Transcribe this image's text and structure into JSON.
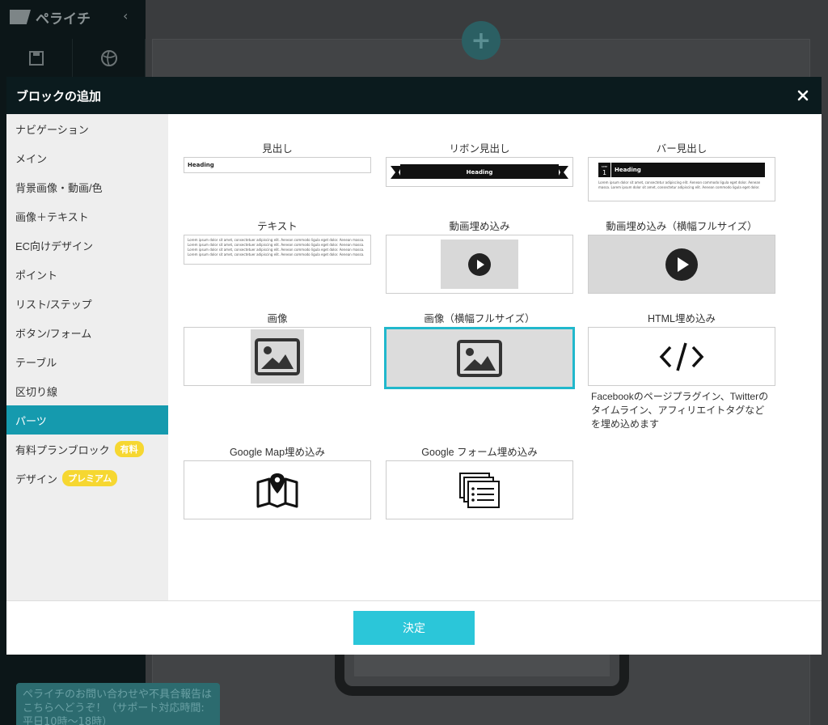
{
  "app": {
    "logo_text": "ペライチ",
    "help_text": "ペライチのお問い合わせや不具合報告はこちらへどうぞ！（サポート対応時間: 平日10時〜18時）"
  },
  "modal": {
    "title": "ブロックの追加",
    "confirm_label": "決定"
  },
  "categories": [
    {
      "label": "ナビゲーション"
    },
    {
      "label": "メイン"
    },
    {
      "label": "背景画像・動画/色"
    },
    {
      "label": "画像＋テキスト"
    },
    {
      "label": "EC向けデザイン"
    },
    {
      "label": "ポイント"
    },
    {
      "label": "リスト/ステップ"
    },
    {
      "label": "ボタン/フォーム"
    },
    {
      "label": "テーブル"
    },
    {
      "label": "区切り線"
    },
    {
      "label": "パーツ",
      "active": true
    },
    {
      "label": "有料プランブロック",
      "badge": "有料"
    },
    {
      "label": "デザイン",
      "badge": "プレミアム"
    }
  ],
  "blocks": {
    "heading": {
      "label": "見出し",
      "sample": "Heading"
    },
    "ribbon": {
      "label": "リボン見出し",
      "sample": "Heading"
    },
    "bar": {
      "label": "バー見出し",
      "sample": "Heading",
      "step_label": "STEP",
      "step_num": "1",
      "body": "Lorem ipsum dolor sit amet, consectetur adipiscing elit. Aenean commodo ligula eget dolor. Aenean massa. Lorem ipsum dolor sit amet, consectetur adipiscing elit. Aenean commodo ligula eget dolor."
    },
    "text": {
      "label": "テキスト",
      "body": "Lorem ipsum dolor sit amet, consectetuer adipiscing elit. Aenean commodo ligula eget dolor. Aenean massa. Lorem ipsum dolor sit amet, consectetuer adipiscing elit. Aenean commodo ligula eget dolor. Aenean massa. Lorem ipsum dolor sit amet, consectetuer adipiscing elit. Aenean commodo ligula eget dolor. Aenean massa. Lorem ipsum dolor sit amet, consectetuer adipiscing elit. Aenean commodo ligula eget dolor. Aenean massa."
    },
    "video": {
      "label": "動画埋め込み"
    },
    "video_full": {
      "label": "動画埋め込み（横幅フルサイズ）"
    },
    "image": {
      "label": "画像"
    },
    "image_full": {
      "label": "画像（横幅フルサイズ）",
      "selected": true
    },
    "html": {
      "label": "HTML埋め込み",
      "description": "Facebookのページプラグイン、Twitterのタイムライン、アフィリエイトタグなどを埋め込めます"
    },
    "gmap": {
      "label": "Google Map埋め込み"
    },
    "gform": {
      "label": "Google フォーム埋め込み"
    }
  },
  "colors": {
    "accent": "#159aae",
    "button": "#2bc6d9",
    "badge": "#f6d731",
    "header": "#0b1b1e"
  }
}
